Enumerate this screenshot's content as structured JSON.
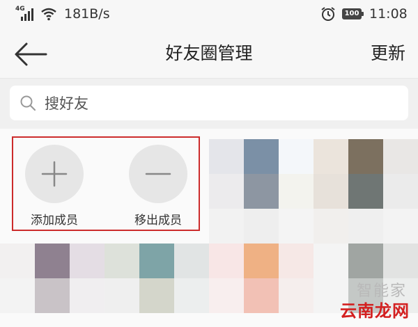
{
  "status_bar": {
    "network": "4G",
    "speed": "181B/s",
    "battery": "100",
    "time": "11:08"
  },
  "nav": {
    "title": "好友圈管理",
    "refresh_label": "更新"
  },
  "search": {
    "placeholder": "搜好友"
  },
  "actions": {
    "add_label": "添加成员",
    "remove_label": "移出成员"
  },
  "watermark": {
    "top_text": "智能家",
    "brand_text": "云南龙网"
  },
  "colors": {
    "highlight_border": "#cc2b2b",
    "action_circle": "#e6e6e6",
    "watermark_red": "#d32020"
  }
}
